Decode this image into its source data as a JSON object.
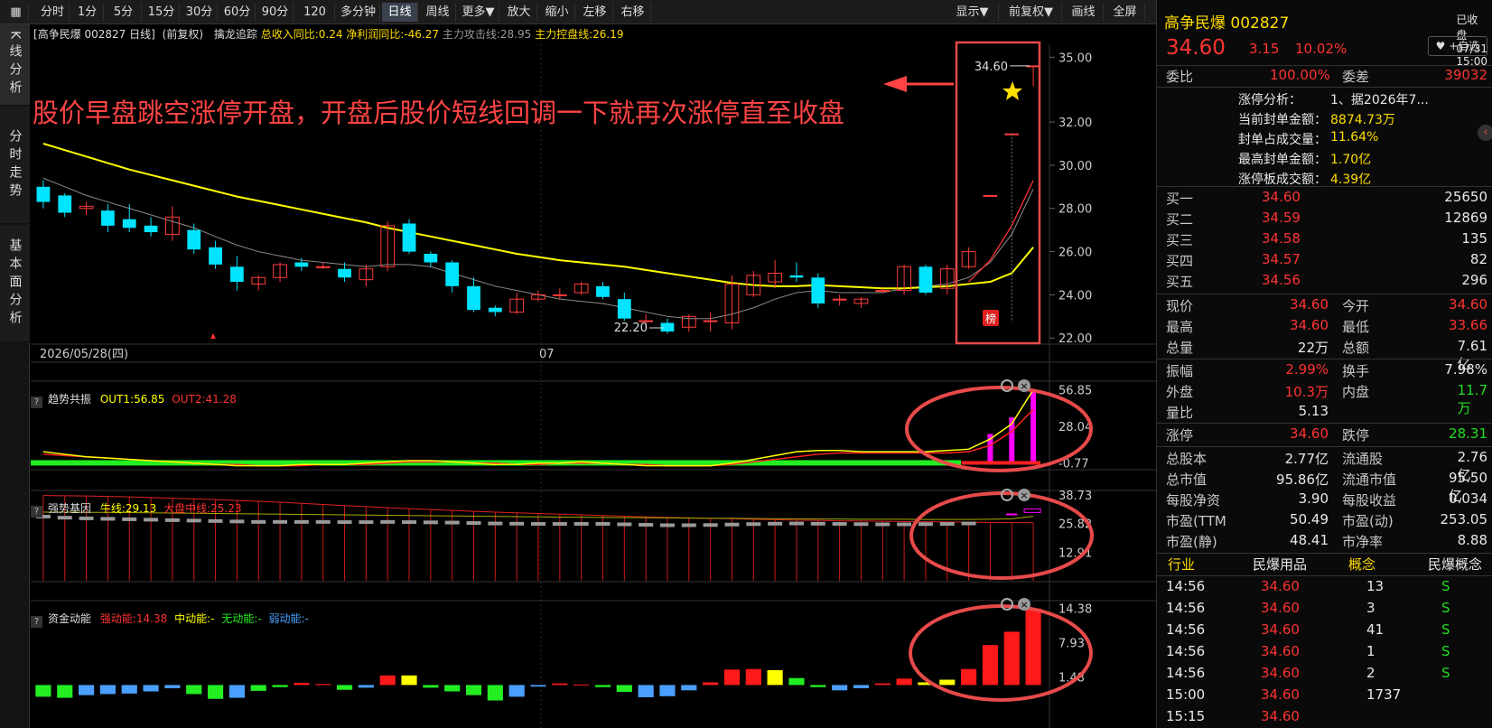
{
  "toolbar": {
    "items": [
      "分时",
      "1分",
      "5分",
      "15分",
      "30分",
      "60分",
      "90分",
      "120分",
      "多分钟",
      "日线",
      "周线",
      "更多▼",
      "放大",
      "缩小",
      "左移",
      "右移"
    ],
    "right_items": [
      "显示▼",
      "前复权▼",
      "画线",
      "全屏"
    ]
  },
  "side_tabs": [
    "K线分析",
    "分时走势",
    "基本面分析"
  ],
  "info": {
    "stock": "高争民爆 002827 日线",
    "fq": "(前复权)",
    "indicator": "擒龙追踪",
    "t1": "总收入同比:0.24",
    "t2": "净利润同比:-46.27",
    "t3": "主力攻击线:28.95",
    "t4": "主力控盘线:26.19"
  },
  "annotation": "股价早盘跳空涨停开盘，开盘后股价短线回调一下就再次涨停直至收盘",
  "marks": {
    "high_label": "34.60",
    "low_label": "22.20",
    "bang": "榜"
  },
  "date_labels": {
    "start": "2026/05/28(四)",
    "mid": "07"
  },
  "price_axis": [
    "35.00",
    "32.00",
    "30.00",
    "28.00",
    "26.00",
    "24.00",
    "22.00"
  ],
  "panels": [
    {
      "title": "趋势共振",
      "a": "OUT1:56.85",
      "b": "OUT2:41.28",
      "c": "",
      "d": "",
      "axis": [
        "56.85",
        "28.04",
        "-0.77"
      ]
    },
    {
      "title": "强势基因",
      "a": "牛线:29.13",
      "b": "大盘中线:25.23",
      "c": "",
      "d": "",
      "axis": [
        "38.73",
        "25.82",
        "12.91"
      ]
    },
    {
      "title": "资金动能",
      "a": "强动能:14.38",
      "b": "中动能:-",
      "c": "无动能:-",
      "d": "弱动能:-",
      "axis": [
        "14.38",
        "7.93",
        "1.48"
      ]
    }
  ],
  "colors": {
    "up": "#ff3c3c",
    "down": "#00e4ff",
    "ma_yellow": "#ffff00",
    "ma_gray": "#8a8a8a",
    "green_line": "#22ee22",
    "magenta": "#ff00ff",
    "annotation": "#ff4444",
    "circle": "#e84a4a"
  },
  "chart_data": {
    "type": "candlestick",
    "candles": [
      [
        29.0,
        28.3,
        29.3,
        28.0
      ],
      [
        28.6,
        27.8,
        28.7,
        27.6
      ],
      [
        28.0,
        28.1,
        28.3,
        27.7
      ],
      [
        27.9,
        27.2,
        28.2,
        26.9
      ],
      [
        27.5,
        27.1,
        28.2,
        26.9
      ],
      [
        27.2,
        26.9,
        27.6,
        26.7
      ],
      [
        26.8,
        27.6,
        28.1,
        26.5
      ],
      [
        27.0,
        26.1,
        27.3,
        25.9
      ],
      [
        26.2,
        25.4,
        26.5,
        25.2
      ],
      [
        25.3,
        24.6,
        25.8,
        24.2
      ],
      [
        24.5,
        24.8,
        24.9,
        24.2
      ],
      [
        24.8,
        25.4,
        25.5,
        24.6
      ],
      [
        25.5,
        25.3,
        25.7,
        25.1
      ],
      [
        25.3,
        25.3,
        25.5,
        25.2
      ],
      [
        25.2,
        24.8,
        25.5,
        24.6
      ],
      [
        24.7,
        25.2,
        25.4,
        24.4
      ],
      [
        25.3,
        27.2,
        27.4,
        25.1
      ],
      [
        27.3,
        26.0,
        27.5,
        25.9
      ],
      [
        25.9,
        25.5,
        26.0,
        25.3
      ],
      [
        25.5,
        24.4,
        25.6,
        24.1
      ],
      [
        24.4,
        23.3,
        24.8,
        23.2
      ],
      [
        23.4,
        23.2,
        23.5,
        23.0
      ],
      [
        23.2,
        23.8,
        24.1,
        23.1
      ],
      [
        23.8,
        24.0,
        24.2,
        23.7
      ],
      [
        24.0,
        24.0,
        24.3,
        23.8
      ],
      [
        24.1,
        24.5,
        24.6,
        24.0
      ],
      [
        24.4,
        23.9,
        24.6,
        23.8
      ],
      [
        23.8,
        22.9,
        24.1,
        22.8
      ],
      [
        22.8,
        22.8,
        23.1,
        22.5
      ],
      [
        22.7,
        22.3,
        22.9,
        22.2
      ],
      [
        22.5,
        23.0,
        23.1,
        22.3
      ],
      [
        22.8,
        22.8,
        23.2,
        22.3
      ],
      [
        22.7,
        24.5,
        24.9,
        22.4
      ],
      [
        24.0,
        24.9,
        25.1,
        23.9
      ],
      [
        24.6,
        25.0,
        25.6,
        24.3
      ],
      [
        24.9,
        24.8,
        25.5,
        24.6
      ],
      [
        24.8,
        23.6,
        25.0,
        23.4
      ],
      [
        23.8,
        23.8,
        24.0,
        23.5
      ],
      [
        23.6,
        23.8,
        23.9,
        23.4
      ],
      [
        24.2,
        24.2,
        24.3,
        24.1
      ],
      [
        24.2,
        25.3,
        25.4,
        24.0
      ],
      [
        25.3,
        24.1,
        25.4,
        24.0
      ],
      [
        24.3,
        25.2,
        25.4,
        24.0
      ],
      [
        25.3,
        26.0,
        26.2,
        25.2
      ],
      [
        28.6,
        28.6,
        28.6,
        28.6
      ],
      [
        31.45,
        31.45,
        31.45,
        31.45
      ],
      [
        34.6,
        34.6,
        34.6,
        33.66
      ]
    ],
    "price_range": [
      21.8,
      35.6
    ],
    "ma_slow": [
      31.0,
      30.7,
      30.4,
      30.1,
      29.8,
      29.55,
      29.3,
      29.05,
      28.8,
      28.55,
      28.35,
      28.15,
      27.95,
      27.75,
      27.55,
      27.35,
      27.1,
      26.9,
      26.7,
      26.5,
      26.3,
      26.1,
      25.9,
      25.75,
      25.6,
      25.5,
      25.4,
      25.3,
      25.15,
      25.0,
      24.85,
      24.7,
      24.55,
      24.45,
      24.4,
      24.4,
      24.45,
      24.4,
      24.35,
      24.3,
      24.3,
      24.35,
      24.4,
      24.5,
      24.6,
      25.0,
      26.2
    ],
    "ma_fast": [
      29.4,
      29.0,
      28.6,
      28.3,
      28.0,
      27.7,
      27.4,
      27.1,
      26.7,
      26.3,
      26.0,
      25.8,
      25.6,
      25.5,
      25.4,
      25.3,
      25.4,
      25.4,
      25.3,
      25.0,
      24.7,
      24.4,
      24.2,
      24.0,
      23.8,
      23.7,
      23.6,
      23.4,
      23.2,
      23.0,
      22.9,
      22.9,
      23.1,
      23.4,
      23.8,
      24.1,
      24.2,
      24.1,
      24.1,
      24.1,
      24.3,
      24.4,
      24.5,
      24.8,
      25.5,
      26.8,
      28.9
    ],
    "panel1": {
      "out1": [
        8,
        6,
        4,
        3,
        2,
        1,
        0,
        -1,
        -2,
        -3,
        -3,
        -3,
        -2,
        -2,
        -2,
        -1,
        0,
        1,
        1,
        0,
        -1,
        -2,
        -2,
        -1,
        -1,
        0,
        -1,
        -2,
        -3,
        -3,
        -3,
        -3,
        -1,
        2,
        5,
        8,
        9,
        9,
        8,
        8,
        8,
        8,
        9,
        10,
        18,
        30,
        56.85
      ],
      "out2": [
        6,
        5,
        4,
        3,
        2,
        1,
        0,
        -1,
        -2,
        -2,
        -3,
        -3,
        -3,
        -2,
        -2,
        -2,
        -1,
        0,
        0,
        0,
        -1,
        -1,
        -2,
        -2,
        -1,
        -1,
        -1,
        -2,
        -2,
        -3,
        -3,
        -3,
        -2,
        0,
        2,
        4,
        6,
        7,
        7,
        7,
        7,
        7,
        7,
        8,
        13,
        24,
        41.28
      ],
      "bars": [
        0,
        0,
        0,
        0,
        0,
        0,
        0,
        0,
        0,
        0,
        0,
        0,
        0,
        0,
        0,
        0,
        0,
        0,
        0,
        0,
        0,
        0,
        0,
        0,
        0,
        0,
        0,
        0,
        0,
        0,
        0,
        0,
        0,
        0,
        0,
        0,
        0,
        0,
        0,
        0,
        0,
        0,
        0,
        0,
        22,
        35,
        56.85
      ],
      "range": [
        -4,
        60
      ]
    },
    "panel2": {
      "bull": [
        38.5,
        38.4,
        38.3,
        38.1,
        37.9,
        37.6,
        37.3,
        37,
        36.7,
        36.3,
        35.9,
        35.5,
        35,
        34.5,
        34,
        33.5,
        33,
        32.6,
        32.2,
        31.8,
        31.4,
        31,
        30.7,
        30.4,
        30.1,
        29.8,
        29.5,
        29.2,
        28.9,
        28.6,
        28.4,
        28.2,
        28,
        27.8,
        27.6,
        27.4,
        27.3,
        27.1,
        27,
        26.9,
        26.8,
        26.7,
        26.6,
        26.5,
        26.4,
        26.3,
        26.2
      ],
      "mid": [
        31,
        31,
        30.9,
        30.9,
        30.8,
        30.7,
        30.6,
        30.5,
        30.4,
        30.3,
        30.2,
        30.1,
        30,
        29.9,
        29.8,
        29.7,
        29.6,
        29.5,
        29.4,
        29.3,
        29.2,
        29.1,
        29,
        28.9,
        28.8,
        28.7,
        28.6,
        28.5,
        28.5,
        28.4,
        28.3,
        28.2,
        28.2,
        28.1,
        28,
        28,
        27.9,
        27.9,
        27.8,
        27.8,
        27.8,
        27.7,
        27.7,
        27.7,
        27.8,
        28.0,
        29.13
      ],
      "gray": [
        29,
        28.5,
        28.2,
        28,
        27.8,
        27.6,
        27.4,
        27.2,
        27,
        26.8,
        26.6,
        26.6,
        26.6,
        26.6,
        26.5,
        26.5,
        26.6,
        26.5,
        26.4,
        26.3,
        26.1,
        25.9,
        25.8,
        25.7,
        25.7,
        25.7,
        25.7,
        25.5,
        25.3,
        25.1,
        25.1,
        25.2,
        25.4,
        25.6,
        25.8,
        25.9,
        25.8,
        25.7,
        25.6,
        25.5,
        25.5,
        25.6,
        25.7,
        25.9,
        0,
        0,
        0
      ],
      "range": [
        0,
        40
      ]
    },
    "panel3": {
      "values": [
        -2.2,
        -2.4,
        -1.9,
        -1.7,
        -1.6,
        -1.2,
        -0.6,
        -1.7,
        -2.6,
        -2.4,
        -1.1,
        -0.4,
        0.4,
        0.2,
        -0.9,
        -0.5,
        1.8,
        1.8,
        -0.5,
        -1.2,
        -1.9,
        -2.9,
        -2.2,
        -0.3,
        0.3,
        0.1,
        -0.4,
        -1.3,
        -2.3,
        -2.1,
        -1.0,
        0.5,
        2.9,
        3.0,
        2.8,
        1.3,
        -0.4,
        -1.0,
        -0.6,
        0.3,
        1.2,
        0.5,
        1.0,
        3.0,
        7.5,
        10.0,
        14.38
      ],
      "colors": [
        "g",
        "g",
        "b",
        "b",
        "b",
        "b",
        "b",
        "g",
        "g",
        "b",
        "g",
        "g",
        "r",
        "r",
        "g",
        "b",
        "r",
        "y",
        "g",
        "g",
        "g",
        "g",
        "b",
        "b",
        "r",
        "r",
        "g",
        "g",
        "b",
        "b",
        "b",
        "r",
        "r",
        "r",
        "y",
        "g",
        "g",
        "b",
        "b",
        "r",
        "r",
        "y",
        "y",
        "r",
        "r",
        "r",
        "r"
      ],
      "range": [
        -4,
        15.5
      ]
    }
  }
}
